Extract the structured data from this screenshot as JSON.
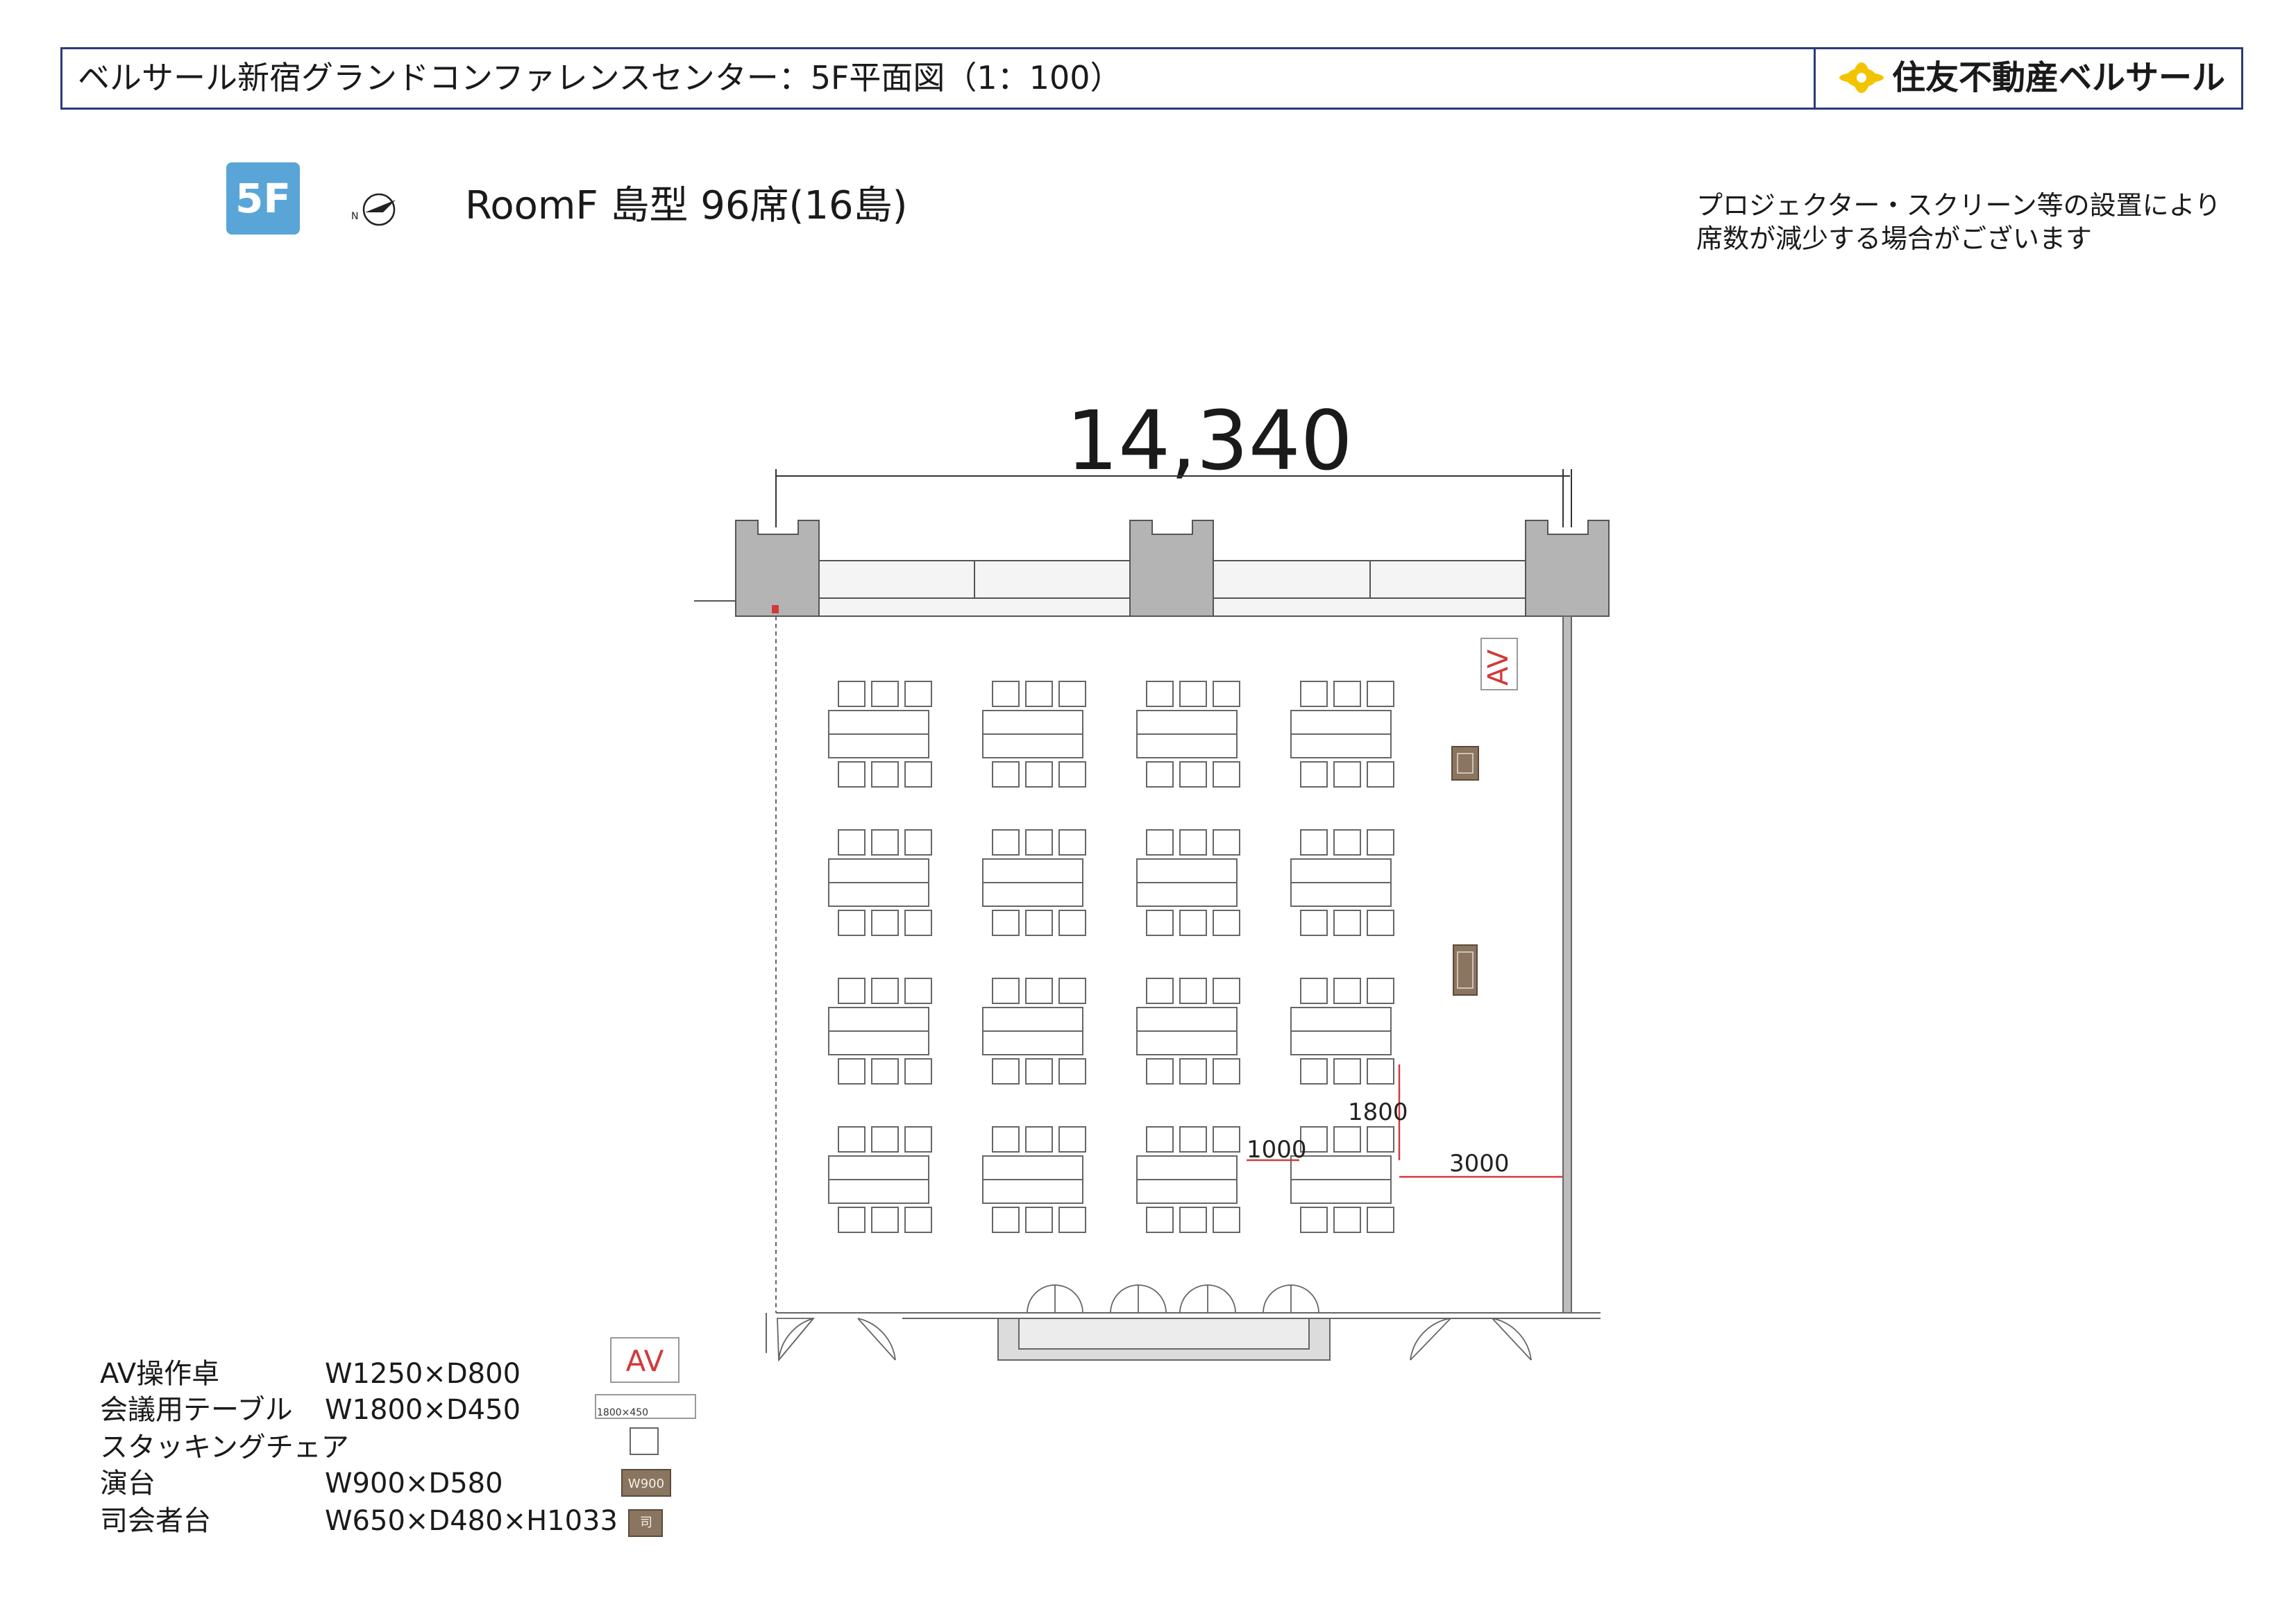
{
  "header": {
    "title": "ベルサール新宿グランドコンファレンスセンター：5F平面図（1：100）",
    "brand": "住友不動産ベルサール"
  },
  "floor_badge": "5F",
  "compass": {
    "label": "N"
  },
  "room": {
    "title": "RoomF 島型 96席(16島)"
  },
  "note": {
    "line1": "プロジェクター・スクリーン等の設置により",
    "line2": "席数が減少する場合がございます"
  },
  "dimensions": {
    "width": "14,340",
    "gap_v": "1800",
    "gap_h": "1000",
    "wall": "3000"
  },
  "plan": {
    "av_label": "AV",
    "podium_label": "W900",
    "mc_label": "司",
    "island_rows": 4,
    "island_cols": 4
  },
  "legend": [
    {
      "name": "AV操作卓",
      "size": "W1250×D800",
      "icon": "av-icon",
      "icon_text": "AV"
    },
    {
      "name": "会議用テーブル",
      "size": "W1800×D450",
      "icon": "table-icon",
      "icon_text": "1800×450"
    },
    {
      "name": "スタッキングチェア",
      "size": "",
      "icon": "chair-icon",
      "icon_text": ""
    },
    {
      "name": "演台",
      "size": "W900×D580",
      "icon": "podium-icon",
      "icon_text": "W900"
    },
    {
      "name": "司会者台",
      "size": "W650×D480×H1033",
      "icon": "mc-stand-icon",
      "icon_text": "司"
    }
  ],
  "colors": {
    "header_border": "#2a3a7a",
    "badge": "#5aa5d8",
    "accent_red": "#d23a3a",
    "furniture_brown": "#8a7560",
    "brand_yellow": "#f2c400"
  }
}
